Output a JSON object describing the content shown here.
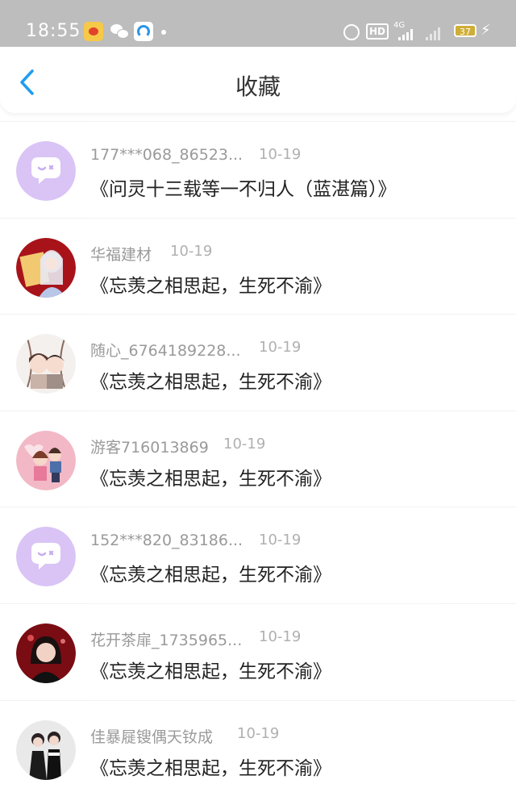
{
  "status_bar": {
    "time": "18:55",
    "hd": "HD",
    "network": "4G",
    "battery": "37"
  },
  "header": {
    "title": "收藏"
  },
  "items": [
    {
      "user": "177***068_86523...",
      "date": "10-19",
      "title": "《问灵十三载等一不归人（蓝湛篇）》",
      "avatar": "default-chat-avatar"
    },
    {
      "user": "华福建材",
      "date": "10-19",
      "title": "《忘羡之相思起，生死不渝》",
      "avatar": "photo-avatar"
    },
    {
      "user": "随心_6764189228...",
      "date": "10-19",
      "title": "《忘羡之相思起，生死不渝》",
      "avatar": "cartoon-avatar"
    },
    {
      "user": "游客716013869",
      "date": "10-19",
      "title": "《忘羡之相思起，生死不渝》",
      "avatar": "cartoon-avatar"
    },
    {
      "user": "152***820_83186...",
      "date": "10-19",
      "title": "《忘羡之相思起，生死不渝》",
      "avatar": "default-chat-avatar"
    },
    {
      "user": "花开茶扉_1735965...",
      "date": "10-19",
      "title": "《忘羡之相思起，生死不渝》",
      "avatar": "photo-avatar"
    },
    {
      "user": "佳暴屣锼偶天钕成",
      "date": "10-19",
      "title": "《忘羡之相思起，生死不渝》",
      "avatar": "photo-avatar"
    }
  ],
  "colors": {
    "status_bar_bg": "#bdbdbd",
    "accent": "#1e9df1",
    "default_avatar": "#d9c4f5"
  }
}
